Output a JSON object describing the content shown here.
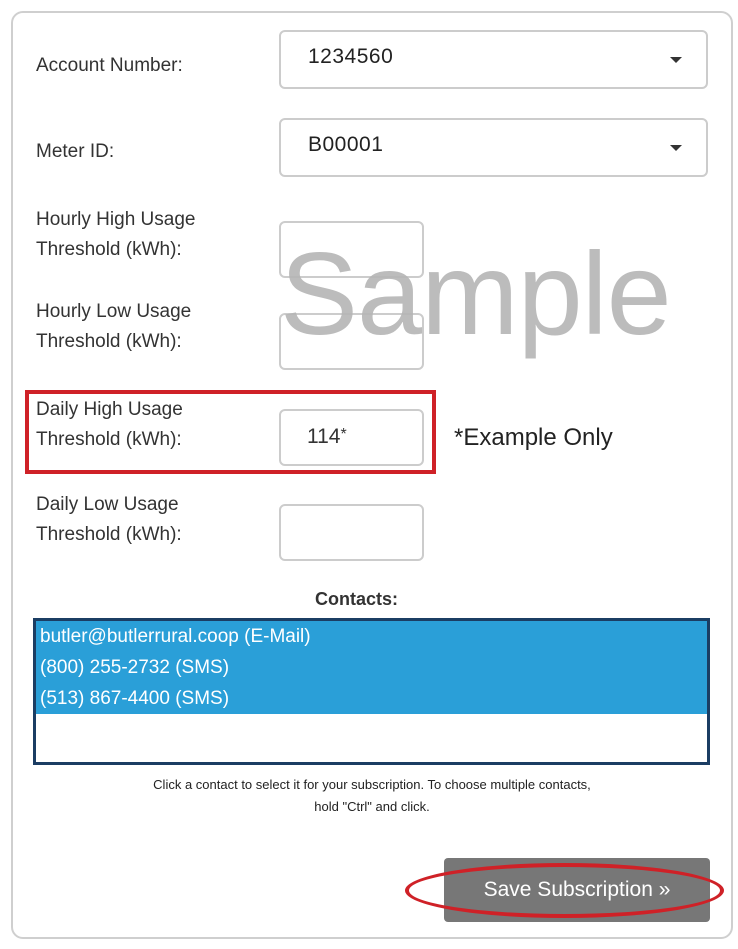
{
  "form": {
    "account_number_label": "Account Number:",
    "account_number_value": "1234560",
    "meter_id_label": "Meter ID:",
    "meter_id_value": "B00001",
    "hourly_high_label_line1": "Hourly High Usage",
    "hourly_high_label_line2": "Threshold (kWh):",
    "hourly_high_value": "",
    "hourly_low_label_line1": "Hourly Low Usage",
    "hourly_low_label_line2": "Threshold (kWh):",
    "hourly_low_value": "",
    "daily_high_label_line1": "Daily High Usage",
    "daily_high_label_line2": "Threshold (kWh):",
    "daily_high_value": "114",
    "daily_high_value_marker": "*",
    "daily_low_label_line1": "Daily Low Usage",
    "daily_low_label_line2": "Threshold (kWh):",
    "daily_low_value": ""
  },
  "watermark": "Sample",
  "example_note": "*Example Only",
  "contacts": {
    "title": "Contacts:",
    "items": [
      {
        "label": "butler@butlerrural.coop (E-Mail)",
        "selected": true
      },
      {
        "label": "(800) 255-2732 (SMS)",
        "selected": true
      },
      {
        "label": "(513) 867-4400 (SMS)",
        "selected": true
      }
    ],
    "help_line1": "Click a contact to select it for your subscription. To choose multiple contacts,",
    "help_line2": "hold \"Ctrl\" and click."
  },
  "save_button_label": "Save Subscription »",
  "colors": {
    "annotation_red": "#cf2127",
    "selection_blue": "#2a9fd8",
    "listbox_border": "#1b3d63",
    "button_gray": "#777777"
  }
}
